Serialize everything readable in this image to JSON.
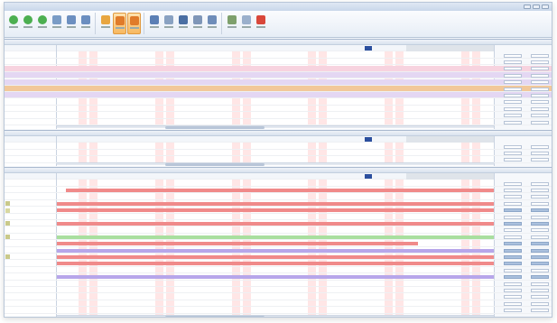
{
  "window": {
    "title": "",
    "controls": [
      "minimize",
      "maximize",
      "close"
    ]
  },
  "toolbar": {
    "buttons": [
      {
        "icon": "green-circle-icon",
        "color": "#4caf50",
        "active": false
      },
      {
        "icon": "green-circle-icon",
        "color": "#4caf50",
        "active": false
      },
      {
        "icon": "green-circle-icon",
        "color": "#4caf50",
        "active": false
      },
      {
        "icon": "calendar-icon",
        "color": "#7a9cc6",
        "active": false
      },
      {
        "icon": "zoom-in-icon",
        "color": "#6c8fc0",
        "active": false
      },
      {
        "icon": "zoom-out-icon",
        "color": "#6c8fc0",
        "active": false
      },
      {
        "icon": "folder-icon",
        "color": "#e8a640",
        "active": false
      },
      {
        "icon": "view-icon",
        "color": "#e07b2a",
        "active": true
      },
      {
        "icon": "view-icon",
        "color": "#e07b2a",
        "active": true
      },
      {
        "icon": "people-icon",
        "color": "#5b7fb5",
        "active": false
      },
      {
        "icon": "list-icon",
        "color": "#8aa2c2",
        "active": false
      },
      {
        "icon": "grid-icon",
        "color": "#4b6fa3",
        "active": false
      },
      {
        "icon": "document-icon",
        "color": "#7f96b8",
        "active": false
      },
      {
        "icon": "chart-icon",
        "color": "#6f8db9",
        "active": false
      },
      {
        "icon": "settings-icon",
        "color": "#7ea06c",
        "active": false
      },
      {
        "icon": "help-icon",
        "color": "#9bb0cc",
        "active": false
      },
      {
        "icon": "exit-icon",
        "color": "#d9473a",
        "active": false
      }
    ]
  },
  "colors": {
    "red_bar": "#f08a8a",
    "green_bar": "#a9df9f",
    "purple_bar": "#b7a6ea",
    "blue_highlight": "#2b4f9e",
    "weekend_stripe": "#ffd2d2",
    "orange_row": "#f2c89a",
    "pink_row": "#f7d3df",
    "lavender_row": "#e4d7f3"
  },
  "panes": {
    "top": {
      "header_label": "",
      "header_center": "",
      "rows": 12
    },
    "middle": {
      "header_label": "",
      "header_center": "",
      "rows": 4
    },
    "bottom": {
      "header_label": "",
      "header_center": "",
      "rows": 21
    }
  }
}
